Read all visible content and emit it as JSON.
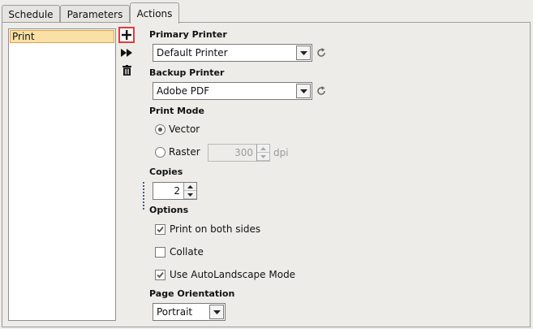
{
  "tabs": [
    {
      "label": "Schedule"
    },
    {
      "label": "Parameters"
    },
    {
      "label": "Actions"
    }
  ],
  "actions_list": {
    "items": [
      {
        "label": "Print"
      }
    ]
  },
  "tools": {
    "add_icon": "plus-icon",
    "run_icon": "fast-forward-icon",
    "delete_icon": "trash-icon"
  },
  "primary_printer": {
    "label": "Primary Printer",
    "value": "Default Printer"
  },
  "backup_printer": {
    "label": "Backup Printer",
    "value": "Adobe PDF"
  },
  "print_mode": {
    "label": "Print Mode",
    "vector_label": "Vector",
    "raster_label": "Raster",
    "selected": "Vector",
    "dpi_value": "300",
    "dpi_unit": "dpi"
  },
  "copies": {
    "label": "Copies",
    "value": "2"
  },
  "options": {
    "label": "Options",
    "both_sides_label": "Print on both sides",
    "both_sides_checked": true,
    "collate_label": "Collate",
    "collate_checked": false,
    "autolandscape_label": "Use AutoLandscape Mode",
    "autolandscape_checked": true
  },
  "page_orientation": {
    "label": "Page Orientation",
    "value": "Portrait"
  },
  "colors": {
    "selection_bg": "#f8e0a6",
    "selection_border": "#e1a04a",
    "highlight": "#e03b3b"
  }
}
